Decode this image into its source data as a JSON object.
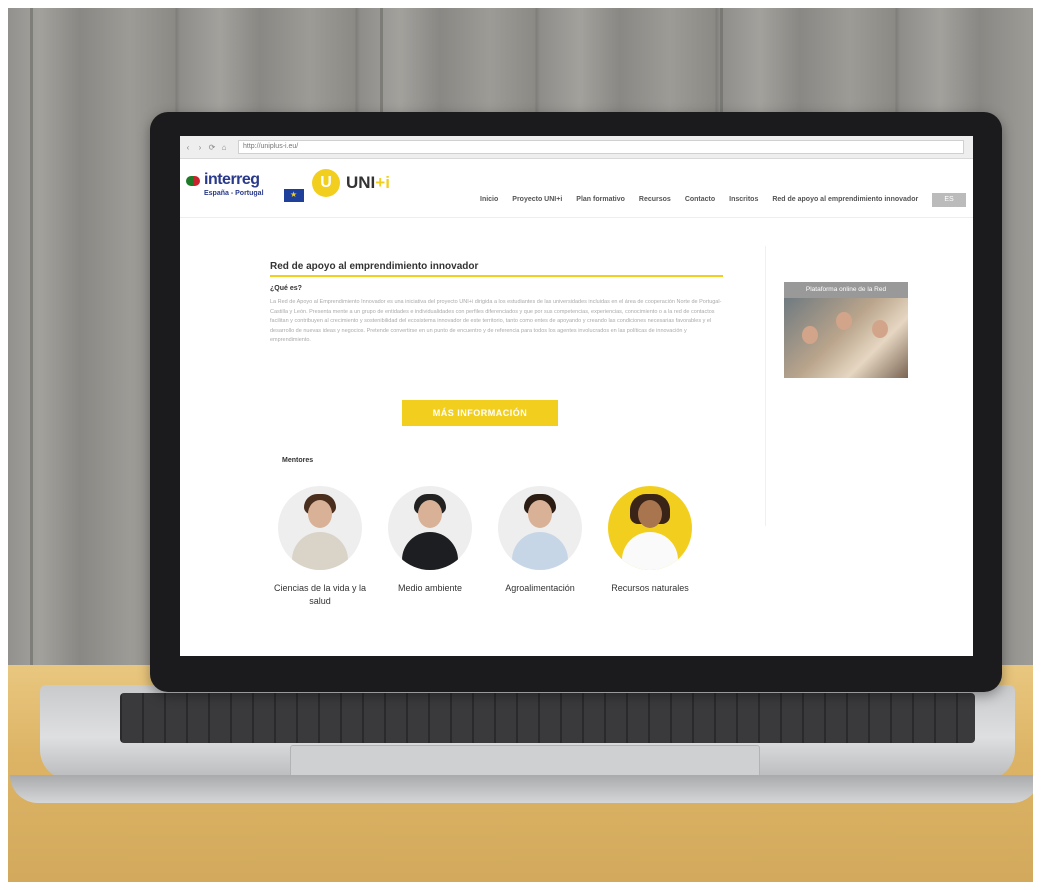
{
  "browser": {
    "url": "http://uniplus-i.eu/",
    "nav_buttons": [
      "‹",
      "›",
      "⟳",
      "⌂"
    ]
  },
  "header": {
    "interreg_title": "interreg",
    "interreg_subtitle": "España - Portugal",
    "uni_letter": "U",
    "uni_text": "UNI",
    "uni_plus": "+i",
    "nav": [
      "Inicio",
      "Proyecto UNI+i",
      "Plan formativo",
      "Recursos",
      "Contacto",
      "Inscritos",
      "Red de apoyo al emprendimiento innovador"
    ],
    "language": "ES"
  },
  "content": {
    "title": "Red de apoyo al emprendimiento innovador",
    "subtitle": "¿Qué es?",
    "paragraph": "La Red de Apoyo al Emprendimiento Innovador es una iniciativa del proyecto UNI+i dirigida a los estudiantes de las universidades incluidas en el área de cooperación Norte de Portugal-Castilla y León. Presenta mente a un grupo de entidades e individualidades con perfiles diferenciados y que por sus competencias, experiencias, conocimiento o a la red de contactos facilitan y contribuyen al crecimiento y sostenibilidad del ecosistema innovador de este territorio, tanto como entes de apoyando y creando las condiciones necesarias favorables y el desarrollo de nuevas ideas y negocios. Pretende convertirse en un punto de encuentro y de referencia para todos los agentes involucrados en las políticas de innovación y emprendimiento.",
    "cta_label": "MÁS INFORMACIÓN",
    "mentors_title": "Mentores",
    "mentors": [
      {
        "label": "Ciencias de la vida y la salud"
      },
      {
        "label": "Medio ambiente"
      },
      {
        "label": "Agroalimentación"
      },
      {
        "label": "Recursos naturales"
      }
    ]
  },
  "sidebar": {
    "title": "Plataforma online de la Red"
  },
  "colors": {
    "accent": "#f2cf1f",
    "brand_blue": "#2a3a8a"
  }
}
